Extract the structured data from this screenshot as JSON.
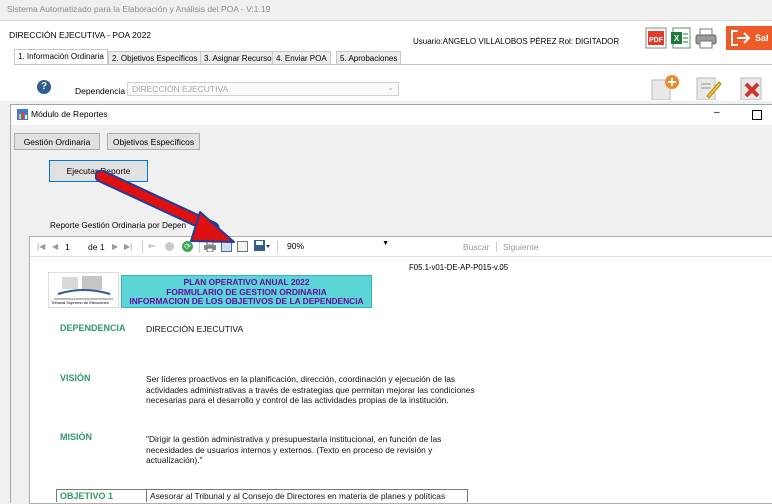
{
  "app": {
    "title": "Sistema Automatizado para la Elaboración y Análisis del POA - V:1.19",
    "context": "DIRECCIÓN EJECUTIVA - POA 2022",
    "user_info": "Usuario:ANGELO VILLALOBOS PÉREZ  Rol: DIGITADOR",
    "exit_label": "Sal",
    "tabs": [
      "1. Información Ordinaria",
      "2. Objetivos Específicos",
      "3. Asignar Recursos",
      "4. Enviar POA",
      "5. Aprobaciones"
    ],
    "dependencia_label": "Dependencia",
    "dependencia_value": "DIRECCIÓN EJECUTIVA"
  },
  "modal": {
    "title": "Módulo de Reportes",
    "buttons": [
      "Gestión Ordinaria",
      "Objetivos Específicos"
    ],
    "run_button": "Ejecutar Reporte",
    "report_caption": "Reporte Gestión Ordinaria por Depen"
  },
  "viewer": {
    "page_current": "1",
    "page_of": "de 1",
    "zoom": "90%",
    "search_label": "Buscar",
    "next_label": "Siguiente"
  },
  "report": {
    "code": "F05.1-v01-DE-AP-P015-v.05",
    "header_lines": [
      "PLAN OPERATIVO ANUAL 2022",
      "FORMULARIO DE GESTION ORDINARIA",
      "INFORMACION DE LOS OBJETIVOS DE LA DEPENDENCIA"
    ],
    "logo_text": "Tribunal Supremo de Elecciones",
    "dependencia_label": "DEPENDENCIA",
    "dependencia_value": "DIRECCIÓN EJECUTIVA",
    "vision_label": "VISIÓN",
    "vision_text": "Ser líderes proactivos en la planificación, dirección, coordinación y ejecución de las actividades administrativas a través de estrategias que permitan mejorar las condiciones necesarias para el desarrollo y control de las actividades propias de la institución.",
    "mision_label": "MISIÓN",
    "mision_text": "\"Dirigir la gestión administrativa y presupuestaria institucional, en función de las necesidades de usuarios internos y externos. (Texto en proceso de revisión y actualización).\"",
    "objetivo_label": "OBJETIVO 1",
    "objetivo_text": "Asesorar al Tribunal y al Consejo de Directores en materia de planes y políticas"
  },
  "colors": {
    "accent_green": "#339966",
    "header_cyan": "#5bd5d5",
    "arrow_red": "#e01010",
    "exit_orange": "#f05a28"
  },
  "icons": [
    "pdf-icon",
    "excel-icon",
    "print-icon",
    "exit-icon",
    "help-icon",
    "add-icon",
    "edit-icon",
    "delete-icon",
    "report-app-icon",
    "first-page-icon",
    "prev-page-icon",
    "next-page-icon",
    "last-page-icon",
    "back-icon",
    "stop-icon",
    "refresh-icon",
    "printer-icon",
    "print-layout-icon",
    "page-setup-icon",
    "export-icon"
  ]
}
